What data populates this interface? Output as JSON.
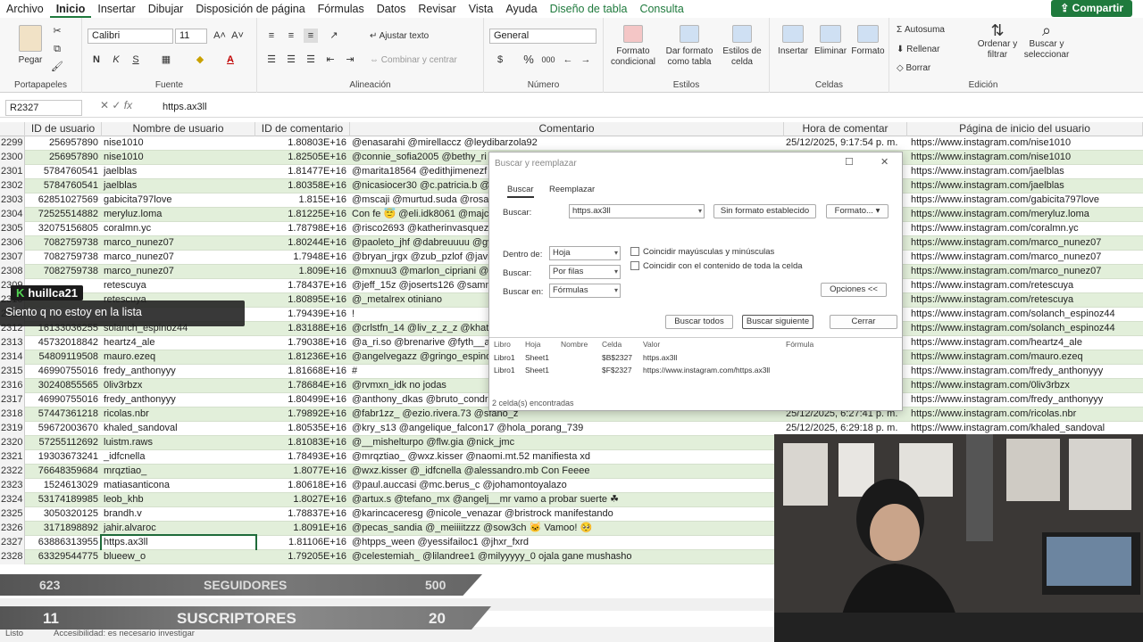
{
  "menu": {
    "items": [
      "Archivo",
      "Inicio",
      "Insertar",
      "Dibujar",
      "Disposición de página",
      "Fórmulas",
      "Datos",
      "Revisar",
      "Vista",
      "Ayuda",
      "Diseño de tabla",
      "Consulta"
    ],
    "share": "Compartir"
  },
  "ribbon": {
    "clipboard": {
      "paste": "Pegar",
      "group": "Portapapeles"
    },
    "font": {
      "name": "Calibri",
      "size": "11",
      "group": "Fuente",
      "bold": "N",
      "italic": "K",
      "underline": "S"
    },
    "alignment": {
      "wrap": "Ajustar texto",
      "merge": "Combinar y centrar",
      "group": "Alineación"
    },
    "number": {
      "format": "General",
      "group": "Número",
      "percent": "%",
      "thousands": "000"
    },
    "styles": {
      "cond": "Formato condicional",
      "table": "Dar formato como tabla",
      "cell": "Estilos de celda",
      "group": "Estilos"
    },
    "cells": {
      "insert": "Insertar",
      "delete": "Eliminar",
      "format": "Formato",
      "group": "Celdas"
    },
    "editing": {
      "autosum": "Autosuma",
      "fill": "Rellenar",
      "clear": "Borrar",
      "sort": "Ordenar y filtrar",
      "find": "Buscar y seleccionar",
      "group": "Edición"
    }
  },
  "formula": {
    "namebox": "R2327",
    "fx": "fx",
    "value": "https.ax3ll"
  },
  "columns": [
    "ID de usuario",
    "Nombre de usuario",
    "ID de comentario",
    "Comentario",
    "Hora de comentar",
    "Página de inicio del usuario"
  ],
  "rows": [
    {
      "n": "2299",
      "uid": "256957890",
      "name": "nise1010",
      "cid": "1.80803E+16",
      "comment": "@enasarahi @mirellaccz @leydibarzola92",
      "time": "25/12/2025, 9:17:54 p. m.",
      "page": "https://www.instagram.com/nise1010"
    },
    {
      "n": "2300",
      "uid": "256957890",
      "name": "nise1010",
      "cid": "1.82505E+16",
      "comment": "@connie_sofia2005 @bethy_ri",
      "time": "",
      "page": "https://www.instagram.com/nise1010"
    },
    {
      "n": "2301",
      "uid": "5784760541",
      "name": "jaelblas",
      "cid": "1.81477E+16",
      "comment": "@marita18564 @edithjimenezf",
      "time": "",
      "page": "https://www.instagram.com/jaelblas"
    },
    {
      "n": "2302",
      "uid": "5784760541",
      "name": "jaelblas",
      "cid": "1.80358E+16",
      "comment": "@nicasiocer30 @c.patricia.b @",
      "time": "",
      "page": "https://www.instagram.com/jaelblas"
    },
    {
      "n": "2303",
      "uid": "62851027569",
      "name": "gabicita797love",
      "cid": "1.815E+16",
      "comment": "@mscaji @murtud.suda @rosa_",
      "time": "",
      "page": "https://www.instagram.com/gabicita797love"
    },
    {
      "n": "2304",
      "uid": "72525514882",
      "name": "meryluz.loma",
      "cid": "1.81225E+16",
      "comment": "Con fe 😇 @eli.idk8061 @majc",
      "time": "",
      "page": "https://www.instagram.com/meryluz.loma"
    },
    {
      "n": "2305",
      "uid": "32075156805",
      "name": "coralmn.yc",
      "cid": "1.78798E+16",
      "comment": "@risco2693 @katherinvasquez",
      "time": "",
      "page": "https://www.instagram.com/coralmn.yc"
    },
    {
      "n": "2306",
      "uid": "7082759738",
      "name": "marco_nunez07",
      "cid": "1.80244E+16",
      "comment": "@paoleto_jhf @dabreuuuu @gy",
      "time": "",
      "page": "https://www.instagram.com/marco_nunez07"
    },
    {
      "n": "2307",
      "uid": "7082759738",
      "name": "marco_nunez07",
      "cid": "1.7948E+16",
      "comment": "@bryan_jrgx @zub_pzlof @javi",
      "time": "",
      "page": "https://www.instagram.com/marco_nunez07"
    },
    {
      "n": "2308",
      "uid": "7082759738",
      "name": "marco_nunez07",
      "cid": "1.809E+16",
      "comment": "@mxnuu3 @marlon_cipriani @",
      "time": "",
      "page": "https://www.instagram.com/marco_nunez07"
    },
    {
      "n": "2309",
      "uid": "",
      "name": "retescuya",
      "cid": "1.78437E+16",
      "comment": "@jeff_15z @joserts126 @samn",
      "time": "",
      "page": "https://www.instagram.com/retescuya"
    },
    {
      "n": "2310",
      "uid": "",
      "name": "retescuya",
      "cid": "1.80895E+16",
      "comment": "@_metalrex otiniano",
      "time": "",
      "page": "https://www.instagram.com/retescuya"
    },
    {
      "n": "2311",
      "uid": "",
      "name": "",
      "cid": "1.79439E+16",
      "comment": "!",
      "time": "",
      "page": "https://www.instagram.com/solanch_espinoz44"
    },
    {
      "n": "2312",
      "uid": "16133036255",
      "name": "solanch_espinoz44",
      "cid": "1.83188E+16",
      "comment": "@crlstfn_14 @liv_z_z_z @khat",
      "time": "",
      "page": "https://www.instagram.com/solanch_espinoz44"
    },
    {
      "n": "2313",
      "uid": "45732018842",
      "name": "heartz4_ale",
      "cid": "1.79038E+16",
      "comment": "@a_ri.so @brenarive @fyth__a",
      "time": "",
      "page": "https://www.instagram.com/heartz4_ale"
    },
    {
      "n": "2314",
      "uid": "54809119508",
      "name": "mauro.ezeq",
      "cid": "1.81236E+16",
      "comment": "@angelvegazz @gringo_espinoz",
      "time": "",
      "page": "https://www.instagram.com/mauro.ezeq"
    },
    {
      "n": "2315",
      "uid": "46990755016",
      "name": "fredy_anthonyyy",
      "cid": "1.81668E+16",
      "comment": "#",
      "time": "",
      "page": "https://www.instagram.com/fredy_anthonyyy"
    },
    {
      "n": "2316",
      "uid": "30240855565",
      "name": "0liv3rbzx",
      "cid": "1.78684E+16",
      "comment": "@rvmxn_idk no jodas",
      "time": "",
      "page": "https://www.instagram.com/0liv3rbzx"
    },
    {
      "n": "2317",
      "uid": "46990755016",
      "name": "fredy_anthonyyy",
      "cid": "1.80499E+16",
      "comment": "@anthony_dkas @bruto_condr",
      "time": "",
      "page": "https://www.instagram.com/fredy_anthonyyy"
    },
    {
      "n": "2318",
      "uid": "57447361218",
      "name": "ricolas.nbr",
      "cid": "1.79892E+16",
      "comment": "@fabr1zz_ @ezio.rivera.73 @sfano_z",
      "time": "25/12/2025, 6:27:41 p. m.",
      "page": "https://www.instagram.com/ricolas.nbr"
    },
    {
      "n": "2319",
      "uid": "59672003670",
      "name": "khaled_sandoval",
      "cid": "1.80535E+16",
      "comment": "@kry_s13 @angelique_falcon17 @hola_porang_739",
      "time": "25/12/2025, 6:29:18 p. m.",
      "page": "https://www.instagram.com/khaled_sandoval"
    },
    {
      "n": "2320",
      "uid": "57255112692",
      "name": "luistm.raws",
      "cid": "1.81083E+16",
      "comment": "@__mishelturpo @flw.gia @nick_jmc",
      "time": "",
      "page": ""
    },
    {
      "n": "2321",
      "uid": "19303673241",
      "name": "_idfcnella",
      "cid": "1.78493E+16",
      "comment": "@mrqztiao_ @wxz.kisser @naomi.mt.52 manifiesta xd",
      "time": "",
      "page": ""
    },
    {
      "n": "2322",
      "uid": "76648359684",
      "name": "mrqztiao_",
      "cid": "1.8077E+16",
      "comment": "@wxz.kisser @_idfcnella @alessandro.mb Con Feeee",
      "time": "",
      "page": ""
    },
    {
      "n": "2323",
      "uid": "1524613029",
      "name": "matiasanticona",
      "cid": "1.80618E+16",
      "comment": "@paul.auccasi @mc.berus_c @johamontoyalazo",
      "time": "",
      "page": ""
    },
    {
      "n": "2324",
      "uid": "53174189985",
      "name": "leob_khb",
      "cid": "1.8027E+16",
      "comment": "@artux.s @tefano_mx @angelj__mr vamo a probar suerte ☘",
      "time": "",
      "page": ""
    },
    {
      "n": "2325",
      "uid": "3050320125",
      "name": "brandh.v",
      "cid": "1.78837E+16",
      "comment": "@karincaceresg @nicole_venazar @bristrock manifestando",
      "time": "",
      "page": ""
    },
    {
      "n": "2326",
      "uid": "3171898892",
      "name": "jahir.alvaroc",
      "cid": "1.8091E+16",
      "comment": "@pecas_sandia @_meiiiitzzz @sow3ch 🐱 Vamoo! 🥺",
      "time": "",
      "page": ""
    },
    {
      "n": "2327",
      "uid": "63886313955",
      "name": "https.ax3ll",
      "cid": "1.81106E+16",
      "comment": "@htpps_ween @yessifailoc1 @jhxr_fxrd",
      "time": "",
      "page": ""
    },
    {
      "n": "2328",
      "uid": "63329544775",
      "name": "blueew_o",
      "cid": "1.79205E+16",
      "comment": "@celestemiah_ @lilandree1 @milyyyyy_0 ojala gane mushasho",
      "time": "",
      "page": ""
    }
  ],
  "dialog": {
    "title": "Buscar y reemplazar",
    "tabs": [
      "Buscar",
      "Reemplazar"
    ],
    "find_label": "Buscar:",
    "find_value": "https.ax3ll",
    "no_format": "Sin formato establecido",
    "format_btn": "Formato...",
    "within_label": "Dentro de:",
    "within_value": "Hoja",
    "search_label": "Buscar:",
    "search_value": "Por filas",
    "lookin_label": "Buscar en:",
    "lookin_value": "Fórmulas",
    "match_case": "Coincidir mayúsculas y minúsculas",
    "match_entire": "Coincidir con el contenido de toda la celda",
    "options_btn": "Opciones <<",
    "find_all": "Buscar todos",
    "find_next": "Buscar siguiente",
    "close": "Cerrar",
    "result_headers": [
      "Libro",
      "Hoja",
      "Nombre",
      "Celda",
      "Valor",
      "Fórmula"
    ],
    "results": [
      {
        "book": "Libro1",
        "sheet": "Sheet1",
        "cell": "$B$2327",
        "value": "https.ax3ll"
      },
      {
        "book": "Libro1",
        "sheet": "Sheet1",
        "cell": "$F$2327",
        "value": "https://www.instagram.com/https.ax3ll"
      }
    ],
    "found": "2 celda(s) encontradas"
  },
  "chat": {
    "user": "huillca21",
    "message": "Siento q no estoy en la lista"
  },
  "overlay": {
    "followers_count": "623",
    "followers_label": "SEGUIDORES",
    "followers_goal": "500",
    "subs_count": "11",
    "subs_label": "SUSCRIPTORES",
    "subs_goal": "20"
  },
  "status": {
    "ready": "Listo",
    "accessibility": "Accesibilidad: es necesario investigar"
  }
}
